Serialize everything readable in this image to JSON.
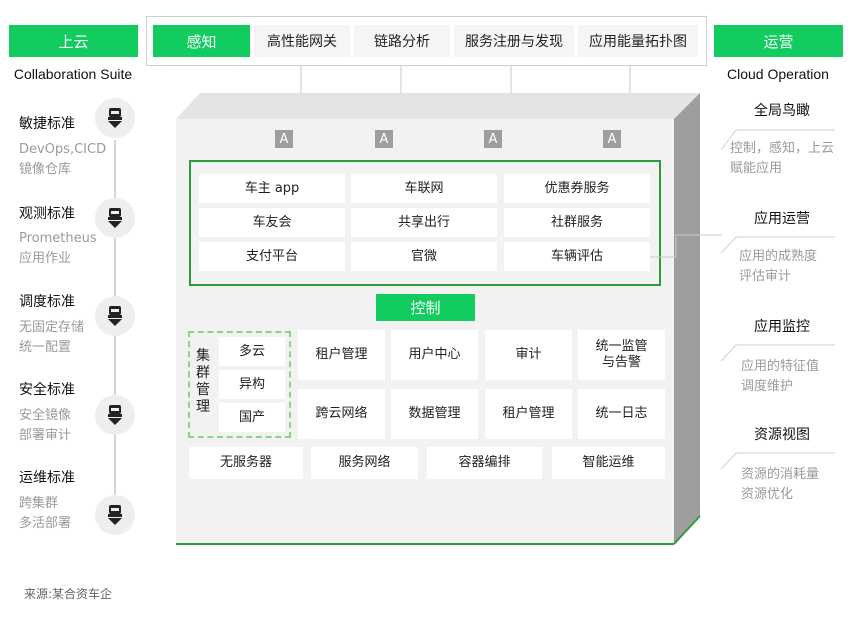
{
  "left": {
    "tab_label": "上云",
    "subtitle": "Collaboration Suite",
    "standards": [
      {
        "title": "敏捷标准",
        "lines": [
          "DevOps,CICD",
          "镜像仓库"
        ],
        "icon": "robot-icon"
      },
      {
        "title": "观测标准",
        "lines": [
          "Prometheus",
          "应用作业"
        ],
        "icon": "robot-icon"
      },
      {
        "title": "调度标准",
        "lines": [
          "无固定存储",
          "统一配置"
        ],
        "icon": "robot-icon"
      },
      {
        "title": "安全标准",
        "lines": [
          "安全镜像",
          "部署审计"
        ],
        "icon": "robot-icon"
      },
      {
        "title": "运维标准",
        "lines": [
          "跨集群",
          "多活部署"
        ],
        "icon": "robot-icon"
      }
    ]
  },
  "top": {
    "tab_label": "感知",
    "items": [
      "高性能网关",
      "链路分析",
      "服务注册与发现",
      "应用能量拓扑图"
    ]
  },
  "right": {
    "tab_label": "运营",
    "subtitle": "Cloud Operation",
    "items": [
      {
        "title": "全局鸟瞰",
        "lines": [
          "控制，感知，上云",
          "赋能应用"
        ]
      },
      {
        "title": "应用运营",
        "lines": [
          "应用的成熟度",
          "评估审计"
        ]
      },
      {
        "title": "应用监控",
        "lines": [
          "应用的特征值",
          "调度维护"
        ]
      },
      {
        "title": "资源视图",
        "lines": [
          "资源的消耗量",
          "资源优化"
        ]
      }
    ]
  },
  "box": {
    "app_grid": [
      [
        "车主 app",
        "车联网",
        "优惠券服务"
      ],
      [
        "车友会",
        "共享出行",
        "社群服务"
      ],
      [
        "支付平台",
        "官微",
        "车辆评估"
      ]
    ],
    "control_label": "控制",
    "cluster": {
      "label_chars": [
        "集",
        "群",
        "管",
        "理"
      ],
      "items": [
        "多云",
        "异构",
        "国产"
      ]
    },
    "control_grid": [
      [
        "租户管理",
        "用户中心",
        "审计",
        "统一监管\n与告警"
      ],
      [
        "跨云网络",
        "数据管理",
        "租户管理",
        "统一日志"
      ]
    ],
    "bottom_row": [
      "无服务器",
      "服务网络",
      "容器编排",
      "智能运维"
    ]
  },
  "footer": "来源:某合资车企",
  "colors": {
    "accent": "#13cc5f",
    "border_green": "#2f9a3a",
    "icon_gray": "#9e9e9e"
  }
}
